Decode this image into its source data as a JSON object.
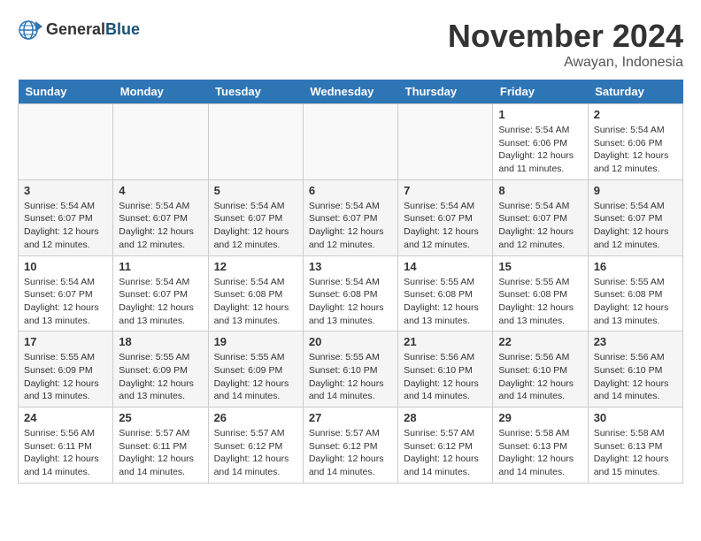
{
  "header": {
    "logo_line1": "General",
    "logo_line2": "Blue",
    "month": "November 2024",
    "location": "Awayan, Indonesia"
  },
  "days_of_week": [
    "Sunday",
    "Monday",
    "Tuesday",
    "Wednesday",
    "Thursday",
    "Friday",
    "Saturday"
  ],
  "weeks": [
    [
      {
        "day": "",
        "info": ""
      },
      {
        "day": "",
        "info": ""
      },
      {
        "day": "",
        "info": ""
      },
      {
        "day": "",
        "info": ""
      },
      {
        "day": "",
        "info": ""
      },
      {
        "day": "1",
        "info": "Sunrise: 5:54 AM\nSunset: 6:06 PM\nDaylight: 12 hours\nand 11 minutes."
      },
      {
        "day": "2",
        "info": "Sunrise: 5:54 AM\nSunset: 6:06 PM\nDaylight: 12 hours\nand 12 minutes."
      }
    ],
    [
      {
        "day": "3",
        "info": "Sunrise: 5:54 AM\nSunset: 6:07 PM\nDaylight: 12 hours\nand 12 minutes."
      },
      {
        "day": "4",
        "info": "Sunrise: 5:54 AM\nSunset: 6:07 PM\nDaylight: 12 hours\nand 12 minutes."
      },
      {
        "day": "5",
        "info": "Sunrise: 5:54 AM\nSunset: 6:07 PM\nDaylight: 12 hours\nand 12 minutes."
      },
      {
        "day": "6",
        "info": "Sunrise: 5:54 AM\nSunset: 6:07 PM\nDaylight: 12 hours\nand 12 minutes."
      },
      {
        "day": "7",
        "info": "Sunrise: 5:54 AM\nSunset: 6:07 PM\nDaylight: 12 hours\nand 12 minutes."
      },
      {
        "day": "8",
        "info": "Sunrise: 5:54 AM\nSunset: 6:07 PM\nDaylight: 12 hours\nand 12 minutes."
      },
      {
        "day": "9",
        "info": "Sunrise: 5:54 AM\nSunset: 6:07 PM\nDaylight: 12 hours\nand 12 minutes."
      }
    ],
    [
      {
        "day": "10",
        "info": "Sunrise: 5:54 AM\nSunset: 6:07 PM\nDaylight: 12 hours\nand 13 minutes."
      },
      {
        "day": "11",
        "info": "Sunrise: 5:54 AM\nSunset: 6:07 PM\nDaylight: 12 hours\nand 13 minutes."
      },
      {
        "day": "12",
        "info": "Sunrise: 5:54 AM\nSunset: 6:08 PM\nDaylight: 12 hours\nand 13 minutes."
      },
      {
        "day": "13",
        "info": "Sunrise: 5:54 AM\nSunset: 6:08 PM\nDaylight: 12 hours\nand 13 minutes."
      },
      {
        "day": "14",
        "info": "Sunrise: 5:55 AM\nSunset: 6:08 PM\nDaylight: 12 hours\nand 13 minutes."
      },
      {
        "day": "15",
        "info": "Sunrise: 5:55 AM\nSunset: 6:08 PM\nDaylight: 12 hours\nand 13 minutes."
      },
      {
        "day": "16",
        "info": "Sunrise: 5:55 AM\nSunset: 6:08 PM\nDaylight: 12 hours\nand 13 minutes."
      }
    ],
    [
      {
        "day": "17",
        "info": "Sunrise: 5:55 AM\nSunset: 6:09 PM\nDaylight: 12 hours\nand 13 minutes."
      },
      {
        "day": "18",
        "info": "Sunrise: 5:55 AM\nSunset: 6:09 PM\nDaylight: 12 hours\nand 13 minutes."
      },
      {
        "day": "19",
        "info": "Sunrise: 5:55 AM\nSunset: 6:09 PM\nDaylight: 12 hours\nand 14 minutes."
      },
      {
        "day": "20",
        "info": "Sunrise: 5:55 AM\nSunset: 6:10 PM\nDaylight: 12 hours\nand 14 minutes."
      },
      {
        "day": "21",
        "info": "Sunrise: 5:56 AM\nSunset: 6:10 PM\nDaylight: 12 hours\nand 14 minutes."
      },
      {
        "day": "22",
        "info": "Sunrise: 5:56 AM\nSunset: 6:10 PM\nDaylight: 12 hours\nand 14 minutes."
      },
      {
        "day": "23",
        "info": "Sunrise: 5:56 AM\nSunset: 6:10 PM\nDaylight: 12 hours\nand 14 minutes."
      }
    ],
    [
      {
        "day": "24",
        "info": "Sunrise: 5:56 AM\nSunset: 6:11 PM\nDaylight: 12 hours\nand 14 minutes."
      },
      {
        "day": "25",
        "info": "Sunrise: 5:57 AM\nSunset: 6:11 PM\nDaylight: 12 hours\nand 14 minutes."
      },
      {
        "day": "26",
        "info": "Sunrise: 5:57 AM\nSunset: 6:12 PM\nDaylight: 12 hours\nand 14 minutes."
      },
      {
        "day": "27",
        "info": "Sunrise: 5:57 AM\nSunset: 6:12 PM\nDaylight: 12 hours\nand 14 minutes."
      },
      {
        "day": "28",
        "info": "Sunrise: 5:57 AM\nSunset: 6:12 PM\nDaylight: 12 hours\nand 14 minutes."
      },
      {
        "day": "29",
        "info": "Sunrise: 5:58 AM\nSunset: 6:13 PM\nDaylight: 12 hours\nand 14 minutes."
      },
      {
        "day": "30",
        "info": "Sunrise: 5:58 AM\nSunset: 6:13 PM\nDaylight: 12 hours\nand 15 minutes."
      }
    ]
  ]
}
